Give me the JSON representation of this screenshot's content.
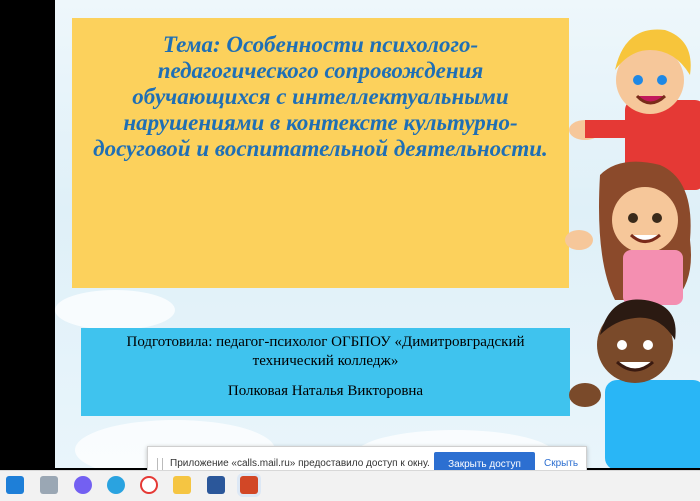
{
  "slide": {
    "title": "Тема: Особенности психолого-педагогического сопровождения обучающихся с интеллектуальными нарушениями в контексте культурно-досуговой и  воспитательной деятельности.",
    "author_line1": "Подготовила: педагог-психолог ОГБПОУ «Димитровградский технический колледж»",
    "author_line2": "Полковая Наталья Викторовна"
  },
  "notification": {
    "message": "Приложение «calls.mail.ru» предоставило доступ к окну.",
    "share_button": "Закрыть доступ",
    "hide_link": "Скрыть"
  },
  "taskbar": {
    "icons": [
      "windows-icon",
      "file-icon",
      "viber-icon",
      "telegram-icon",
      "yandex-browser-icon",
      "folder-icon",
      "word-icon",
      "powerpoint-icon"
    ]
  },
  "colors": {
    "title_box": "#fcd15c",
    "title_text": "#1f6fb5",
    "author_box": "#3fc3ee",
    "share_button": "#2c6fd1"
  }
}
